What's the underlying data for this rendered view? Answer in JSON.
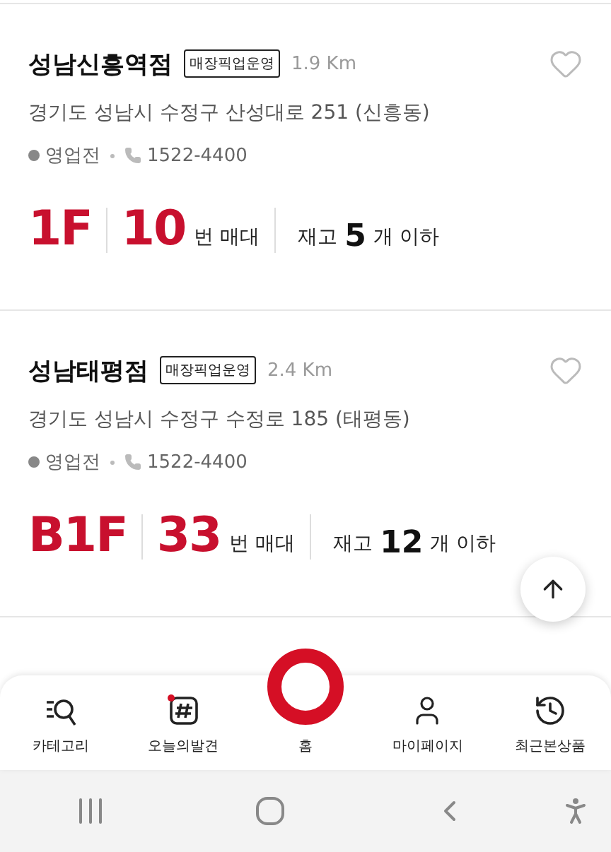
{
  "stores": [
    {
      "name": "성남신흥역점",
      "badge": "매장픽업운영",
      "distance": "1.9 Km",
      "favorite": false,
      "address": "경기도 성남시 수정구 산성대로 251 (신흥동)",
      "status": "영업전",
      "phone": "1522-4400",
      "floor": "1F",
      "shelf": "10",
      "shelf_unit": "번 매대",
      "stock_label": "재고",
      "stock": "5",
      "stock_unit": "개 이하"
    },
    {
      "name": "성남태평점",
      "badge": "매장픽업운영",
      "distance": "2.4 Km",
      "favorite": false,
      "address": "경기도 성남시 수정구 수정로 185 (태평동)",
      "status": "영업전",
      "phone": "1522-4400",
      "floor": "B1F",
      "shelf": "33",
      "shelf_unit": "번 매대",
      "stock_label": "재고",
      "stock": "12",
      "stock_unit": "개 이하"
    }
  ],
  "nav": [
    {
      "kind": "category",
      "label": "카테고리"
    },
    {
      "kind": "discover",
      "label": "오늘의발견"
    },
    {
      "kind": "home",
      "label": "홈"
    },
    {
      "kind": "mypage",
      "label": "마이페이지"
    },
    {
      "kind": "recent",
      "label": "최근본상품"
    }
  ]
}
